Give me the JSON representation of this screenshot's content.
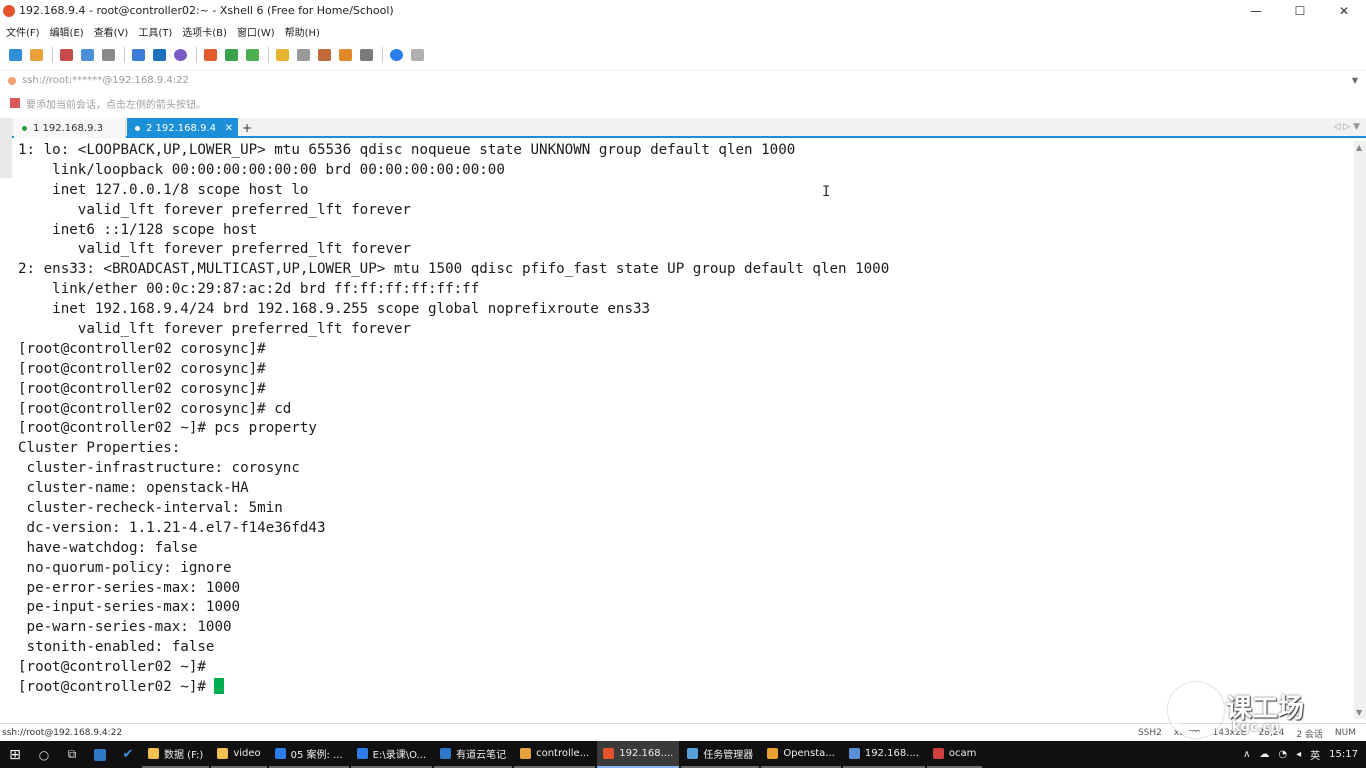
{
  "window": {
    "title": "192.168.9.4 - root@controller02:~ - Xshell 6 (Free for Home/School)",
    "minimize": "—",
    "maximize": "☐",
    "close": "✕"
  },
  "menu": [
    "文件(F)",
    "编辑(E)",
    "查看(V)",
    "工具(T)",
    "选项卡(B)",
    "窗口(W)",
    "帮助(H)"
  ],
  "toolbar": {
    "colors": [
      "#2f8fd6",
      "#e9a23b",
      "#c74b4b",
      "#4a90d9",
      "#8a8a8a",
      "#3b7dd8",
      "#1f6fbf",
      "#7b5cc4",
      "#e35a2c",
      "#3aa04a",
      "#4caf50",
      "#e6b32e",
      "#9a9a9a",
      "#c06a3a",
      "#e28a2a",
      "#7a7a7a",
      "#2b7de9",
      "#b0b0b0"
    ]
  },
  "address": {
    "text": "ssh://root:******@192.168.9.4:22",
    "arrow": "▼"
  },
  "hint": {
    "text": "要添加当前会话，点击左侧的箭头按钮。"
  },
  "tabs": [
    {
      "label": "1 192.168.9.3"
    },
    {
      "label": "2 192.168.9.4",
      "close": "✕"
    }
  ],
  "tab_add": "+",
  "tab_nav": "◁ ▷ ▼",
  "terminal": {
    "lines": [
      "1: lo: <LOOPBACK,UP,LOWER_UP> mtu 65536 qdisc noqueue state UNKNOWN group default qlen 1000",
      "    link/loopback 00:00:00:00:00:00 brd 00:00:00:00:00:00",
      "    inet 127.0.0.1/8 scope host lo",
      "       valid_lft forever preferred_lft forever",
      "    inet6 ::1/128 scope host",
      "       valid_lft forever preferred_lft forever",
      "2: ens33: <BROADCAST,MULTICAST,UP,LOWER_UP> mtu 1500 qdisc pfifo_fast state UP group default qlen 1000",
      "    link/ether 00:0c:29:87:ac:2d brd ff:ff:ff:ff:ff:ff",
      "    inet 192.168.9.4/24 brd 192.168.9.255 scope global noprefixroute ens33",
      "       valid_lft forever preferred_lft forever",
      "[root@controller02 corosync]#",
      "[root@controller02 corosync]#",
      "[root@controller02 corosync]#",
      "[root@controller02 corosync]# cd",
      "[root@controller02 ~]# pcs property",
      "Cluster Properties:",
      " cluster-infrastructure: corosync",
      " cluster-name: openstack-HA",
      " cluster-recheck-interval: 5min",
      " dc-version: 1.1.21-4.el7-f14e36fd43",
      " have-watchdog: false",
      " no-quorum-policy: ignore",
      " pe-error-series-max: 1000",
      " pe-input-series-max: 1000",
      " pe-warn-series-max: 1000",
      " stonith-enabled: false",
      "[root@controller02 ~]#",
      "[root@controller02 ~]# "
    ],
    "cursor_color": "#00b050",
    "ibeam": "I"
  },
  "status": {
    "left": "ssh://root@192.168.9.4:22",
    "protocol": "SSH2",
    "term": "xterm",
    "size": "143x28",
    "pos": "28,24",
    "sessions": "2 会话",
    "num": "NUM"
  },
  "watermark": {
    "text": "课工场",
    "sub": "kgc.cn"
  },
  "taskbar": {
    "start": "⊞",
    "search": "○",
    "taskview": "⧉",
    "apps": [
      {
        "label": "数据 (F:)",
        "color": "#f2c14e"
      },
      {
        "label": "video",
        "color": "#f2c14e"
      },
      {
        "label": "05 案例: ...",
        "color": "#2b7de9"
      },
      {
        "label": "E:\\录课\\O...",
        "color": "#2b7de9"
      },
      {
        "label": "有道云笔记",
        "color": "#2f77c8"
      },
      {
        "label": "controlle...",
        "color": "#e9a23b"
      },
      {
        "label": "192.168....",
        "color": "#e5532d"
      },
      {
        "label": "任务管理器",
        "color": "#5aa0d8"
      },
      {
        "label": "Opensta...",
        "color": "#e8a030"
      },
      {
        "label": "192.168....",
        "color": "#5a8fd8"
      },
      {
        "label": "ocam",
        "color": "#d04040"
      }
    ],
    "tray": {
      "up": "∧",
      "lang": "英",
      "time": "15:17"
    }
  }
}
